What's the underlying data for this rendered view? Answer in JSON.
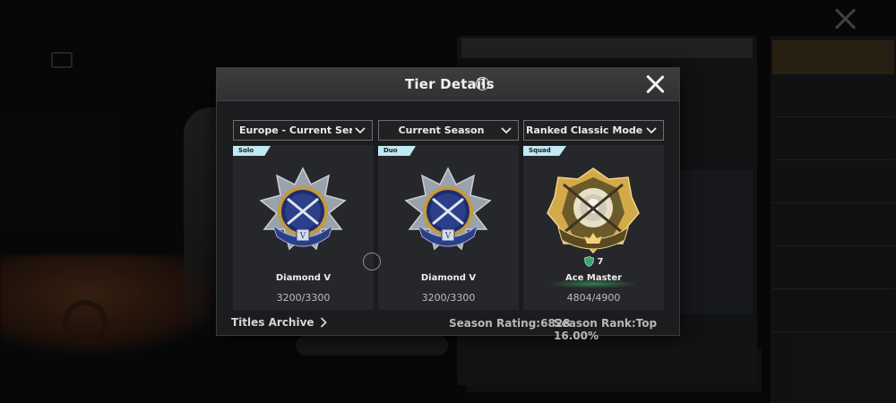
{
  "modal": {
    "title": "Tier Details",
    "help_icon": "question-circle-icon",
    "close_icon": "close-icon"
  },
  "filters": [
    {
      "label": "Europe - Current Server",
      "icon": "chevron-down-icon"
    },
    {
      "label": "Current Season",
      "icon": "chevron-down-icon"
    },
    {
      "label": "Ranked Classic Mode (TPP)",
      "icon": "chevron-down-icon"
    }
  ],
  "cards": [
    {
      "tag": "Solo",
      "tier": "Diamond V",
      "points": "3200/3300",
      "badge": "diamond-badge-icon"
    },
    {
      "tag": "Duo",
      "tier": "Diamond V",
      "points": "3200/3300",
      "badge": "diamond-badge-icon"
    },
    {
      "tag": "Squad",
      "tier": "Ace Master",
      "points": "4804/4900",
      "badge": "ace-badge-icon",
      "level": "7",
      "level_icon": "shield-level-icon"
    }
  ],
  "footer": {
    "titles_archive": "Titles Archive",
    "titles_archive_icon": "chevron-right-icon",
    "season_rating": "Season Rating:6828",
    "season_rank": "Season Rank:Top 16.00%"
  },
  "colors": {
    "tag_bg": "#bfe9f3",
    "modal_bg": "#1b1c1d",
    "card_bg": "#26272a",
    "ace_glow": "#3cc86e"
  }
}
